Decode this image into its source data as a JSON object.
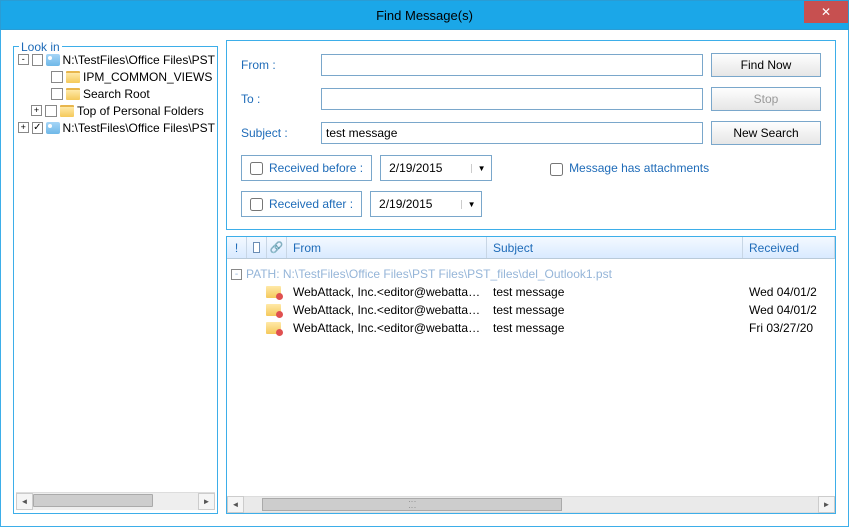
{
  "titlebar": {
    "title": "Find Message(s)",
    "close_icon": "✕"
  },
  "left": {
    "group_label": "Look in",
    "tree": [
      {
        "indent": 0,
        "expander": "-",
        "checked": false,
        "icon": "pst",
        "label": "N:\\TestFiles\\Office Files\\PST"
      },
      {
        "indent": 1,
        "expander": "",
        "checked": false,
        "icon": "folder",
        "label": "IPM_COMMON_VIEWS"
      },
      {
        "indent": 1,
        "expander": "",
        "checked": false,
        "icon": "folder",
        "label": "Search Root"
      },
      {
        "indent": 1,
        "expander": "+",
        "checked": false,
        "icon": "folder",
        "label": "Top of Personal Folders"
      },
      {
        "indent": 0,
        "expander": "+",
        "checked": true,
        "icon": "pst",
        "label": "N:\\TestFiles\\Office Files\\PST"
      }
    ],
    "scroll_left": "◄",
    "scroll_right": "►"
  },
  "search": {
    "from_label": "From :",
    "to_label": "To :",
    "subject_label": "Subject :",
    "from_value": "",
    "to_value": "",
    "subject_value": "test message",
    "received_before_label": "Received before :",
    "received_after_label": "Received after :",
    "received_before_value": "2/19/2015",
    "received_after_value": "2/19/2015",
    "attachments_label": "Message has attachments",
    "buttons": {
      "find_now": "Find Now",
      "stop": "Stop",
      "new_search": "New Search"
    }
  },
  "results": {
    "columns": {
      "priority": "!",
      "icon": "🗎",
      "attach": "📎",
      "from": "From",
      "subject": "Subject",
      "received": "Received"
    },
    "path_label": "PATH:  N:\\TestFiles\\Office Files\\PST Files\\PST_files\\del_Outlook1.pst",
    "rows": [
      {
        "from": "WebAttack, Inc.<editor@webattack.c...",
        "subject": "test message",
        "received": "Wed 04/01/2"
      },
      {
        "from": "WebAttack, Inc.<editor@webattack.c...",
        "subject": "test message",
        "received": "Wed 04/01/2"
      },
      {
        "from": "WebAttack, Inc.<editor@webattack.c...",
        "subject": "test message",
        "received": "Fri 03/27/20"
      }
    ],
    "scroll_left": "◄",
    "scroll_right": "►"
  }
}
